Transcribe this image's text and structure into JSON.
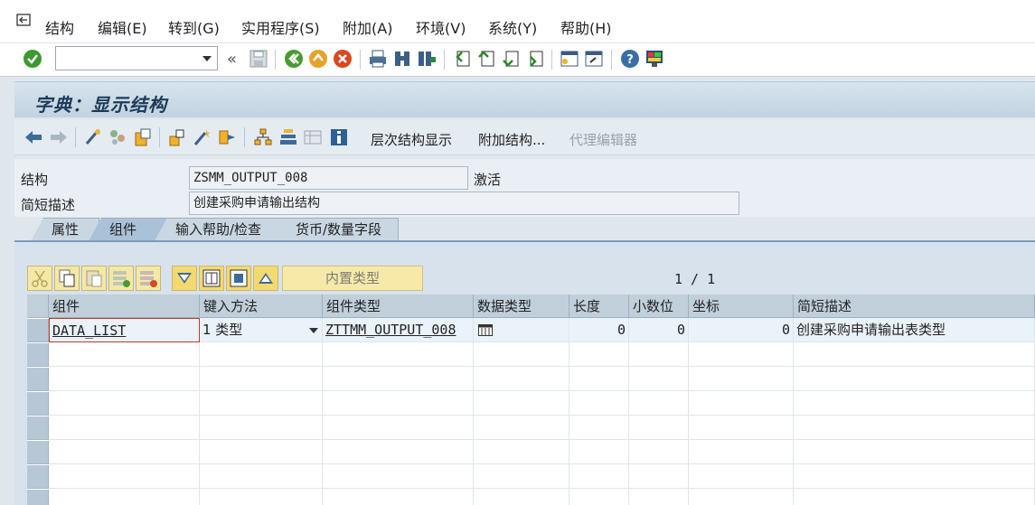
{
  "menu": {
    "items": [
      "结构",
      "编辑(E)",
      "转到(G)",
      "实用程序(S)",
      "附加(A)",
      "环境(V)",
      "系统(Y)",
      "帮助(H)"
    ]
  },
  "command_field": {
    "value": ""
  },
  "title": "字典：显示结构",
  "app_toolbar": {
    "hierarchy_label": "层次结构显示",
    "append_label": "附加结构...",
    "proxy_label": "代理编辑器"
  },
  "form": {
    "structure_label": "结构",
    "structure_value": "ZSMM_OUTPUT_008",
    "status": "激活",
    "desc_label": "简短描述",
    "desc_value": "创建采购申请输出结构"
  },
  "tabs": [
    "属性",
    "组件",
    "输入帮助/检查",
    "货币/数量字段"
  ],
  "active_tab": "组件",
  "table_toolbar": {
    "inner_type_label": "内置类型",
    "pager": "1 / 1"
  },
  "table": {
    "columns": [
      "组件",
      "键入方法",
      "组件类型",
      "数据类型",
      "长度",
      "小数位",
      "坐标",
      "简短描述"
    ],
    "rows": [
      {
        "component": "DATA_LIST",
        "typing": "1 类型",
        "comp_type": "ZTTMM_OUTPUT_008",
        "data_type": "",
        "length": "0",
        "decimals": "0",
        "coord": "0",
        "desc": "创建采购申请输出表类型"
      }
    ]
  }
}
